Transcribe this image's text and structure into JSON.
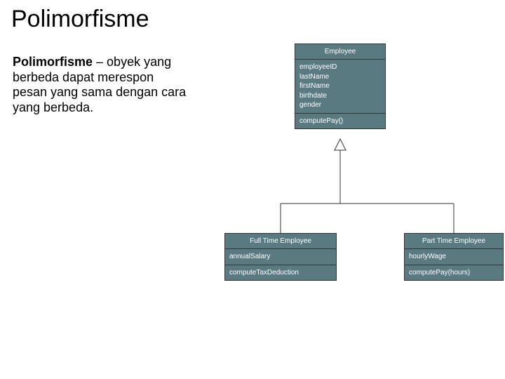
{
  "title": "Polimorfisme",
  "desc_bold": "Polimorfisme",
  "desc_rest": " – obyek yang berbeda dapat merespon pesan yang sama dengan cara yang berbeda.",
  "diagram": {
    "employee": {
      "name": "Employee",
      "attrs": [
        "employeeID",
        "lastName",
        "firstName",
        "birthdate",
        "gender"
      ],
      "ops": [
        "computePay()"
      ]
    },
    "fullTime": {
      "name": "Full Time Employee",
      "attrs": [
        "annualSalary"
      ],
      "ops": [
        "computeTaxDeduction"
      ]
    },
    "partTime": {
      "name": "Part Time Employee",
      "attrs": [
        "hourlyWage"
      ],
      "ops": [
        "computePay(hours)"
      ]
    }
  }
}
